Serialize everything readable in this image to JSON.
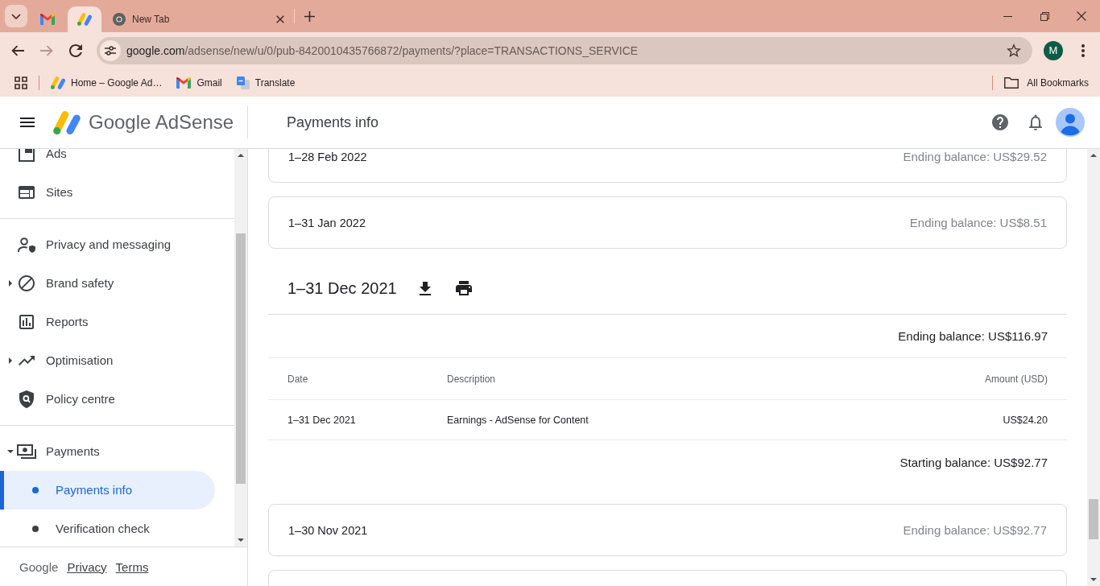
{
  "browser": {
    "tabs": [
      {
        "kind": "pinned",
        "selected": false
      },
      {
        "kind": "pinned",
        "selected": true
      },
      {
        "kind": "normal",
        "title": "New Tab",
        "selected": false
      }
    ],
    "nav_buttons": [
      {
        "kind": "back",
        "disabled": false
      },
      {
        "kind": "forward",
        "disabled": true
      },
      {
        "kind": "reload",
        "disabled": false
      }
    ],
    "address": "google.com/adsense/new/u/0/pub-8420010435766872/payments/?place=TRANSACTIONS_SERVICE",
    "profile_initial": "M",
    "bookmarks": [
      {
        "title": "Home – Google Ad…"
      },
      {
        "title": "Gmail"
      },
      {
        "title": "Translate"
      }
    ],
    "all_bookmarks": "All Bookmarks"
  },
  "app": {
    "product": "Google AdSense",
    "page_title": "Payments info"
  },
  "sidebar": {
    "sections": [
      {
        "items": [
          {
            "label": "Ads",
            "selected": false
          },
          {
            "label": "Sites",
            "selected": false
          }
        ]
      },
      {
        "items": [
          {
            "label": "Privacy and messaging",
            "selected": false
          },
          {
            "label": "Brand safety",
            "expanded": false,
            "selected": false
          },
          {
            "label": "Reports",
            "selected": false
          },
          {
            "label": "Optimisation",
            "expanded": false,
            "selected": false
          },
          {
            "label": "Policy centre",
            "selected": false
          }
        ]
      },
      {
        "items": [
          {
            "label": "Payments",
            "expanded": true,
            "selected": false,
            "children": [
              {
                "label": "Payments info",
                "selected": true
              },
              {
                "label": "Verification check",
                "selected": false
              }
            ]
          }
        ]
      }
    ],
    "footer": {
      "brand": "Google",
      "links": [
        "Privacy",
        "Terms"
      ]
    }
  },
  "statements": [
    {
      "period": "1–28 Feb 2022",
      "ending_balance": "Ending balance: US$29.52",
      "expanded": false
    },
    {
      "period": "1–31 Jan 2022",
      "ending_balance": "Ending balance: US$8.51",
      "expanded": false
    },
    {
      "period": "1–31 Dec 2021",
      "ending_balance": "Ending balance: US$116.97",
      "expanded": true,
      "table": {
        "columns": [
          "Date",
          "Description",
          "Amount (USD)"
        ],
        "rows": [
          [
            "1–31 Dec 2021",
            "Earnings - AdSense for Content",
            "US$24.20"
          ]
        ]
      },
      "starting_balance": "Starting balance: US$92.77"
    },
    {
      "period": "1–30 Nov 2021",
      "ending_balance": "Ending balance: US$92.77",
      "expanded": false
    },
    {
      "expanded": false
    }
  ]
}
